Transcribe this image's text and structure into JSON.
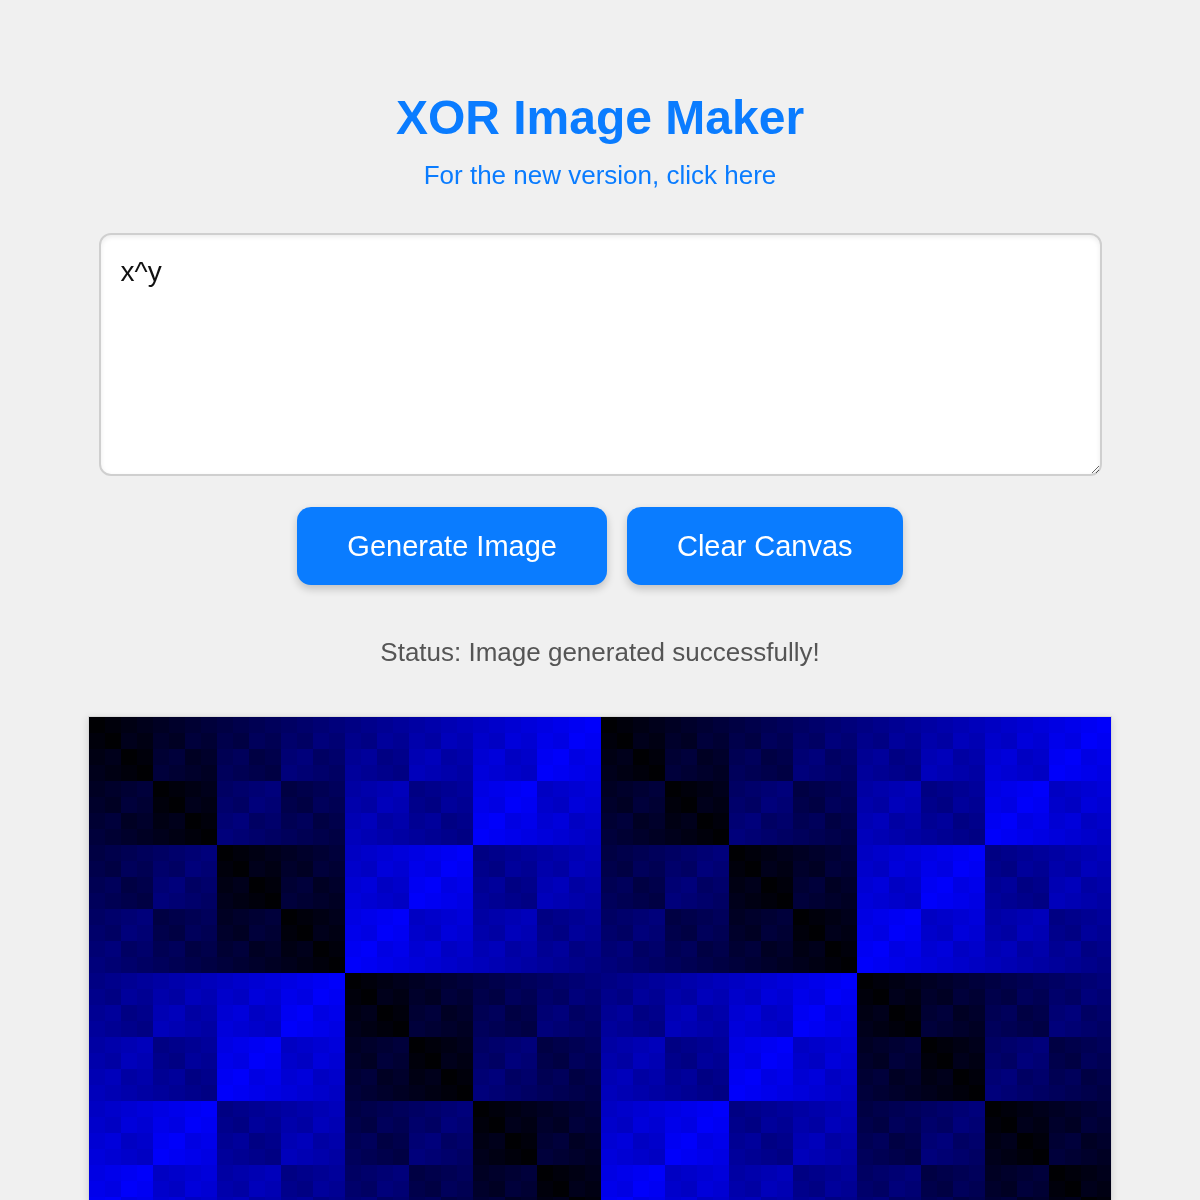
{
  "header": {
    "title": "XOR Image Maker",
    "link": "For the new version, click here"
  },
  "editor": {
    "value": "x^y"
  },
  "buttons": [
    {
      "label": "Generate Image"
    },
    {
      "label": "Clear Canvas"
    }
  ],
  "status": "Status: Image generated successfully!"
}
